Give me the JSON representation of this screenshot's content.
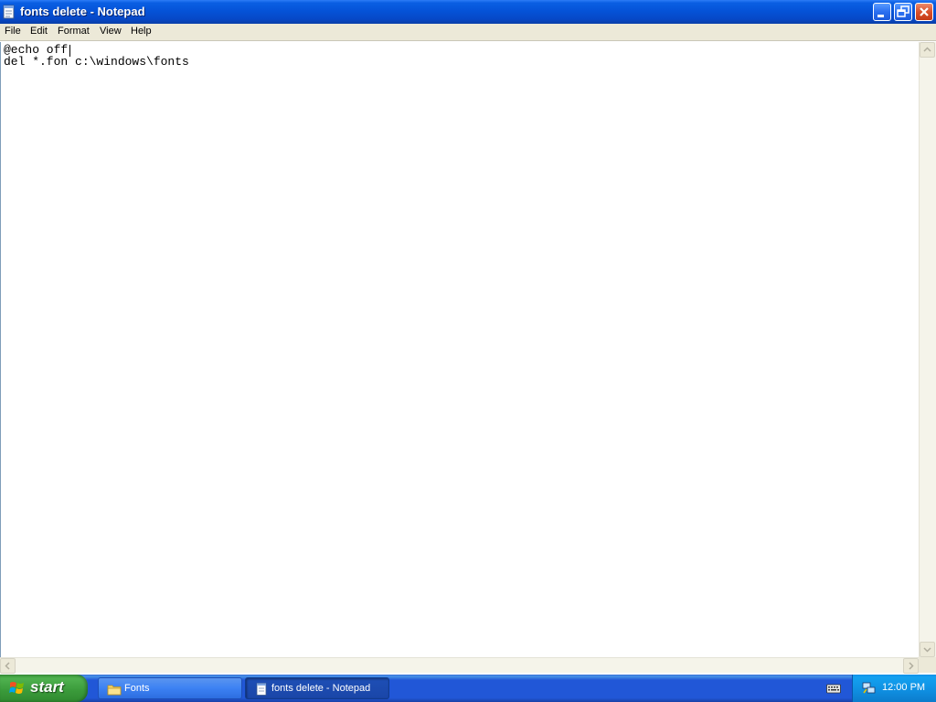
{
  "window": {
    "title": "fonts delete - Notepad",
    "app_icon": "notepad-icon",
    "controls": {
      "minimize": "minimize-icon",
      "maximize": "restore-icon",
      "close": "close-icon"
    }
  },
  "menu": {
    "items": [
      "File",
      "Edit",
      "Format",
      "View",
      "Help"
    ]
  },
  "editor": {
    "lines": [
      "@echo off",
      "del *.fon c:\\windows\\fonts"
    ]
  },
  "taskbar": {
    "start_label": "start",
    "tasks": [
      {
        "label": "Fonts",
        "icon": "folder-icon",
        "active": false
      },
      {
        "label": "fonts delete - Notepad",
        "icon": "notepad-icon",
        "active": true
      }
    ],
    "tray": {
      "clock": "12:00 PM",
      "icons": [
        "keyboard-icon",
        "network-icon"
      ]
    }
  },
  "colors": {
    "titlebar_blue": "#0553d8",
    "taskbar_blue": "#2157d7",
    "start_green": "#3a9a3a",
    "close_red": "#d9502c",
    "menubar_beige": "#ece9d8"
  }
}
